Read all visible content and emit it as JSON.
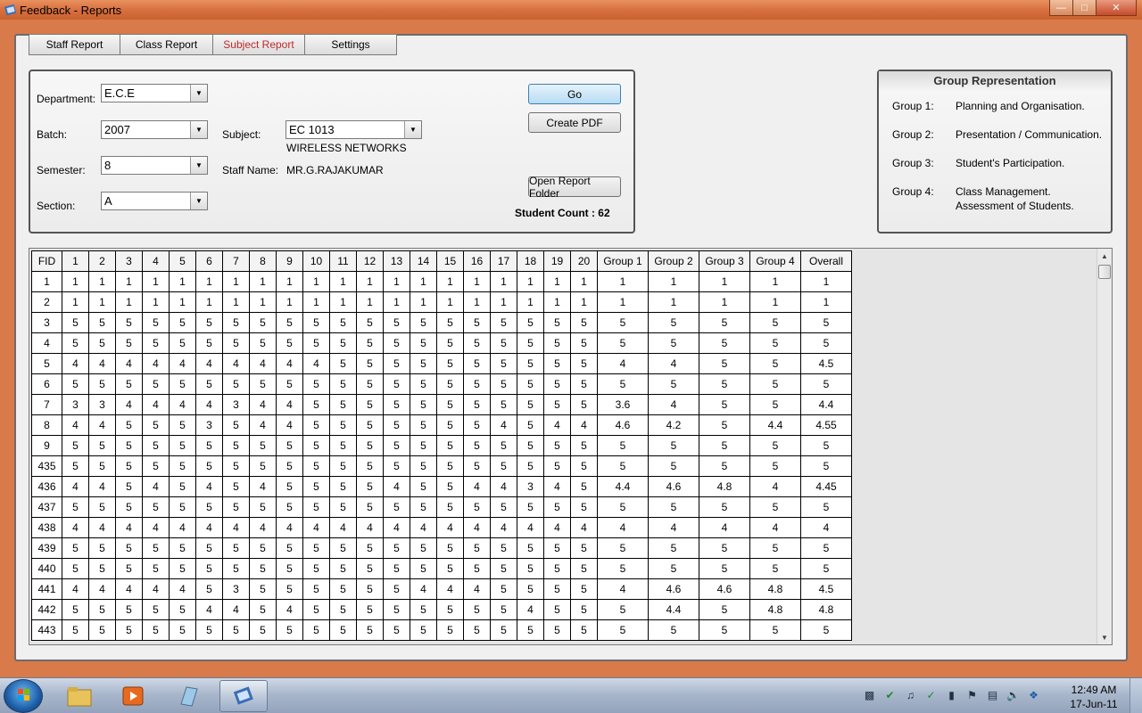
{
  "window": {
    "title": "Feedback - Reports"
  },
  "tabs": [
    {
      "label": "Staff Report"
    },
    {
      "label": "Class Report"
    },
    {
      "label": "Subject Report"
    },
    {
      "label": "Settings"
    }
  ],
  "filters": {
    "department_label": "Department:",
    "department_value": "E.C.E",
    "batch_label": "Batch:",
    "batch_value": "2007",
    "semester_label": "Semester:",
    "semester_value": "8",
    "section_label": "Section:",
    "section_value": "A",
    "subject_label": "Subject:",
    "subject_value": "EC 1013",
    "subject_name": "WIRELESS NETWORKS",
    "staff_label": "Staff  Name:",
    "staff_value": "MR.G.RAJAKUMAR"
  },
  "actions": {
    "go": "Go",
    "create_pdf": "Create PDF",
    "open_folder": "Open Report Folder",
    "student_count": "Student Count :  62"
  },
  "groups": {
    "title": "Group Representation",
    "items": [
      {
        "label": "Group 1:",
        "desc": "Planning and Organisation.",
        "desc2": ""
      },
      {
        "label": "Group 2:",
        "desc": "Presentation / Communication.",
        "desc2": ""
      },
      {
        "label": "Group 3:",
        "desc": "Student's Participation.",
        "desc2": ""
      },
      {
        "label": "Group 4:",
        "desc": "Class Management.",
        "desc2": "Assessment of Students."
      }
    ]
  },
  "grid": {
    "columns": [
      "FID",
      "1",
      "2",
      "3",
      "4",
      "5",
      "6",
      "7",
      "8",
      "9",
      "10",
      "11",
      "12",
      "13",
      "14",
      "15",
      "16",
      "17",
      "18",
      "19",
      "20",
      "Group 1",
      "Group 2",
      "Group 3",
      "Group 4",
      "Overall"
    ],
    "rows": [
      [
        "1",
        "1",
        "1",
        "1",
        "1",
        "1",
        "1",
        "1",
        "1",
        "1",
        "1",
        "1",
        "1",
        "1",
        "1",
        "1",
        "1",
        "1",
        "1",
        "1",
        "1",
        "1",
        "1",
        "1",
        "1",
        "1"
      ],
      [
        "2",
        "1",
        "1",
        "1",
        "1",
        "1",
        "1",
        "1",
        "1",
        "1",
        "1",
        "1",
        "1",
        "1",
        "1",
        "1",
        "1",
        "1",
        "1",
        "1",
        "1",
        "1",
        "1",
        "1",
        "1",
        "1"
      ],
      [
        "3",
        "5",
        "5",
        "5",
        "5",
        "5",
        "5",
        "5",
        "5",
        "5",
        "5",
        "5",
        "5",
        "5",
        "5",
        "5",
        "5",
        "5",
        "5",
        "5",
        "5",
        "5",
        "5",
        "5",
        "5",
        "5"
      ],
      [
        "4",
        "5",
        "5",
        "5",
        "5",
        "5",
        "5",
        "5",
        "5",
        "5",
        "5",
        "5",
        "5",
        "5",
        "5",
        "5",
        "5",
        "5",
        "5",
        "5",
        "5",
        "5",
        "5",
        "5",
        "5",
        "5"
      ],
      [
        "5",
        "4",
        "4",
        "4",
        "4",
        "4",
        "4",
        "4",
        "4",
        "4",
        "4",
        "5",
        "5",
        "5",
        "5",
        "5",
        "5",
        "5",
        "5",
        "5",
        "5",
        "4",
        "4",
        "5",
        "5",
        "4.5"
      ],
      [
        "6",
        "5",
        "5",
        "5",
        "5",
        "5",
        "5",
        "5",
        "5",
        "5",
        "5",
        "5",
        "5",
        "5",
        "5",
        "5",
        "5",
        "5",
        "5",
        "5",
        "5",
        "5",
        "5",
        "5",
        "5",
        "5"
      ],
      [
        "7",
        "3",
        "3",
        "4",
        "4",
        "4",
        "4",
        "3",
        "4",
        "4",
        "5",
        "5",
        "5",
        "5",
        "5",
        "5",
        "5",
        "5",
        "5",
        "5",
        "5",
        "3.6",
        "4",
        "5",
        "5",
        "4.4"
      ],
      [
        "8",
        "4",
        "4",
        "5",
        "5",
        "5",
        "3",
        "5",
        "4",
        "4",
        "5",
        "5",
        "5",
        "5",
        "5",
        "5",
        "5",
        "4",
        "5",
        "4",
        "4",
        "4.6",
        "4.2",
        "5",
        "4.4",
        "4.55"
      ],
      [
        "9",
        "5",
        "5",
        "5",
        "5",
        "5",
        "5",
        "5",
        "5",
        "5",
        "5",
        "5",
        "5",
        "5",
        "5",
        "5",
        "5",
        "5",
        "5",
        "5",
        "5",
        "5",
        "5",
        "5",
        "5",
        "5"
      ],
      [
        "435",
        "5",
        "5",
        "5",
        "5",
        "5",
        "5",
        "5",
        "5",
        "5",
        "5",
        "5",
        "5",
        "5",
        "5",
        "5",
        "5",
        "5",
        "5",
        "5",
        "5",
        "5",
        "5",
        "5",
        "5",
        "5"
      ],
      [
        "436",
        "4",
        "4",
        "5",
        "4",
        "5",
        "4",
        "5",
        "4",
        "5",
        "5",
        "5",
        "5",
        "4",
        "5",
        "5",
        "4",
        "4",
        "3",
        "4",
        "5",
        "4.4",
        "4.6",
        "4.8",
        "4",
        "4.45"
      ],
      [
        "437",
        "5",
        "5",
        "5",
        "5",
        "5",
        "5",
        "5",
        "5",
        "5",
        "5",
        "5",
        "5",
        "5",
        "5",
        "5",
        "5",
        "5",
        "5",
        "5",
        "5",
        "5",
        "5",
        "5",
        "5",
        "5"
      ],
      [
        "438",
        "4",
        "4",
        "4",
        "4",
        "4",
        "4",
        "4",
        "4",
        "4",
        "4",
        "4",
        "4",
        "4",
        "4",
        "4",
        "4",
        "4",
        "4",
        "4",
        "4",
        "4",
        "4",
        "4",
        "4",
        "4"
      ],
      [
        "439",
        "5",
        "5",
        "5",
        "5",
        "5",
        "5",
        "5",
        "5",
        "5",
        "5",
        "5",
        "5",
        "5",
        "5",
        "5",
        "5",
        "5",
        "5",
        "5",
        "5",
        "5",
        "5",
        "5",
        "5",
        "5"
      ],
      [
        "440",
        "5",
        "5",
        "5",
        "5",
        "5",
        "5",
        "5",
        "5",
        "5",
        "5",
        "5",
        "5",
        "5",
        "5",
        "5",
        "5",
        "5",
        "5",
        "5",
        "5",
        "5",
        "5",
        "5",
        "5",
        "5"
      ],
      [
        "441",
        "4",
        "4",
        "4",
        "4",
        "4",
        "5",
        "3",
        "5",
        "5",
        "5",
        "5",
        "5",
        "5",
        "4",
        "4",
        "4",
        "5",
        "5",
        "5",
        "5",
        "4",
        "4.6",
        "4.6",
        "4.8",
        "4.5"
      ],
      [
        "442",
        "5",
        "5",
        "5",
        "5",
        "5",
        "4",
        "4",
        "5",
        "4",
        "5",
        "5",
        "5",
        "5",
        "5",
        "5",
        "5",
        "5",
        "4",
        "5",
        "5",
        "5",
        "4.4",
        "5",
        "4.8",
        "4.8"
      ],
      [
        "443",
        "5",
        "5",
        "5",
        "5",
        "5",
        "5",
        "5",
        "5",
        "5",
        "5",
        "5",
        "5",
        "5",
        "5",
        "5",
        "5",
        "5",
        "5",
        "5",
        "5",
        "5",
        "5",
        "5",
        "5",
        "5"
      ]
    ]
  },
  "taskbar": {
    "time": "12:49 AM",
    "date": "17-Jun-11"
  }
}
